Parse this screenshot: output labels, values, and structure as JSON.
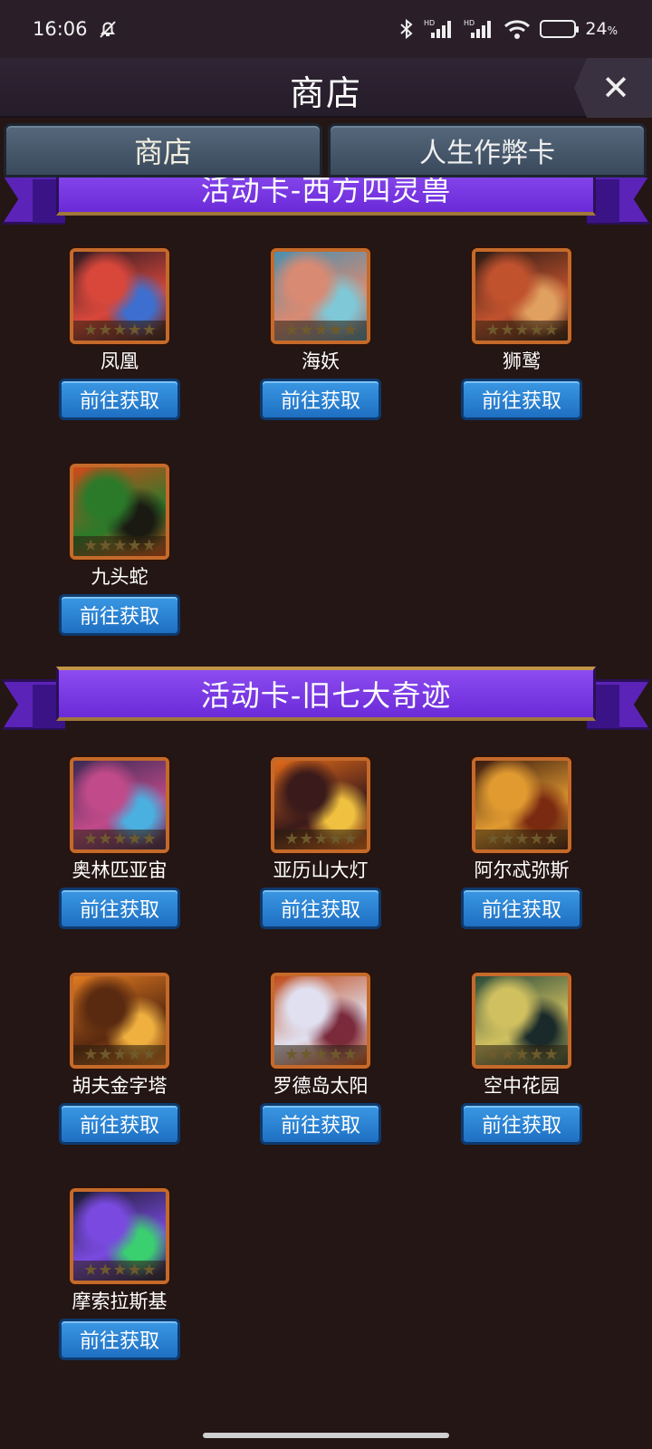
{
  "status_bar": {
    "time": "16:06",
    "battery_percent": "24",
    "battery_unit": "%",
    "battery_level": 0.24,
    "icons": [
      "mute-bell-icon",
      "bluetooth-icon",
      "hd-signal-icon",
      "hd-signal-icon",
      "wifi-icon",
      "battery-icon"
    ]
  },
  "header": {
    "title": "商店",
    "close_icon": "close-icon"
  },
  "tabs": [
    {
      "label": "商店",
      "active": true
    },
    {
      "label": "人生作弊卡",
      "active": false
    }
  ],
  "sections": [
    {
      "title": "活动卡-西方四灵兽",
      "cards": [
        {
          "name": "凤凰",
          "button": "前往获取",
          "colors": [
            "#2b1b22",
            "#d9473b",
            "#3c6fd0"
          ]
        },
        {
          "name": "海妖",
          "button": "前往获取",
          "colors": [
            "#4a8fb0",
            "#d98a72",
            "#7ec8d8"
          ]
        },
        {
          "name": "狮鹫",
          "button": "前往获取",
          "colors": [
            "#2a1a14",
            "#c0522e",
            "#e0a060"
          ]
        },
        {
          "name": "九头蛇",
          "button": "前往获取",
          "colors": [
            "#d04a1a",
            "#2a7a2a",
            "#1a1a12"
          ]
        }
      ]
    },
    {
      "title": "活动卡-旧七大奇迹",
      "cards": [
        {
          "name": "奥林匹亚宙",
          "button": "前往获取",
          "colors": [
            "#3a2a52",
            "#c04a8a",
            "#4ab0e0"
          ]
        },
        {
          "name": "亚历山大灯",
          "button": "前往获取",
          "colors": [
            "#e06a1a",
            "#3a1a1a",
            "#f0c040"
          ]
        },
        {
          "name": "阿尔忒弥斯",
          "button": "前往获取",
          "colors": [
            "#3a1a10",
            "#e09a30",
            "#7a2a10"
          ]
        },
        {
          "name": "胡夫金字塔",
          "button": "前往获取",
          "colors": [
            "#e07a20",
            "#5a2a10",
            "#f0b040"
          ]
        },
        {
          "name": "罗德岛太阳",
          "button": "前往获取",
          "colors": [
            "#c04a1a",
            "#e0e0f0",
            "#7a2a3a"
          ]
        },
        {
          "name": "空中花园",
          "button": "前往获取",
          "colors": [
            "#2a4a3a",
            "#d0c060",
            "#1a2a2a"
          ]
        },
        {
          "name": "摩索拉斯基",
          "button": "前往获取",
          "colors": [
            "#1a1a2a",
            "#7a4ae0",
            "#3ad070"
          ]
        }
      ]
    }
  ]
}
